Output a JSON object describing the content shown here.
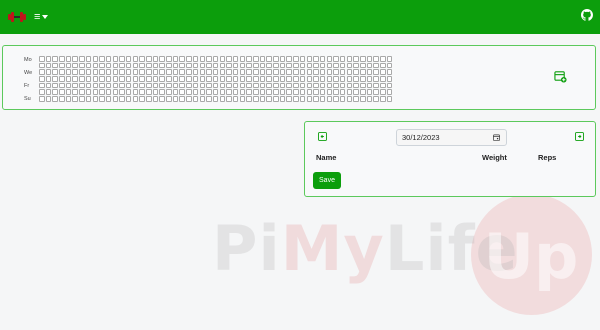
{
  "navbar": {
    "menu_icon": "hamburger-menu-icon",
    "logo_icon": "dumbbell-logo-icon",
    "github_icon": "github-icon",
    "accent_color": "#0c9e0c"
  },
  "heatmap": {
    "day_labels": [
      "Mo",
      "We",
      "Fr",
      "Su"
    ],
    "add_icon": "calendar-plus-icon"
  },
  "workout": {
    "prev_icon": "arrow-left-square-icon",
    "next_icon": "arrow-right-square-icon",
    "date_value": "30/12/2023",
    "calendar_icon": "calendar-icon",
    "columns": {
      "name": "Name",
      "weight": "Weight",
      "reps": "Reps"
    },
    "save_label": "Save"
  },
  "watermark": {
    "text_pi": "Pi",
    "text_my": "My",
    "text_life": "Life",
    "text_up": "Up"
  }
}
